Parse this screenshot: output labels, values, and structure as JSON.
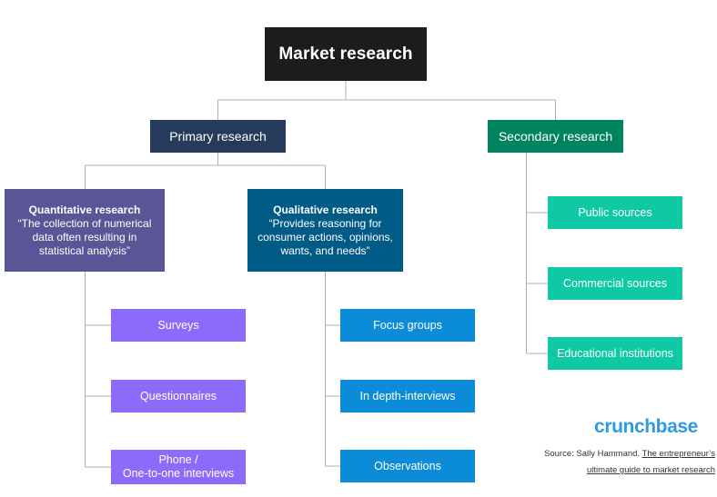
{
  "diagram": {
    "root": {
      "label": "Market research"
    },
    "branches": [
      {
        "id": "primary",
        "label": "Primary research"
      },
      {
        "id": "secondary",
        "label": "Secondary research"
      }
    ],
    "definitions": [
      {
        "id": "quantitative",
        "title": "Quantitative research",
        "description": "“The collection of numerical data often resulting in statistical analysis”"
      },
      {
        "id": "qualitative",
        "title": "Qualitative research",
        "description": "“Provides reasoning for consumer actions, opinions, wants, and needs”"
      }
    ],
    "quantitative_methods": [
      {
        "label": "Surveys"
      },
      {
        "label": "Questionnaires"
      },
      {
        "label": "Phone /\nOne-to-one interviews"
      }
    ],
    "qualitative_methods": [
      {
        "label": "Focus groups"
      },
      {
        "label": "In depth-interviews"
      },
      {
        "label": "Observations"
      }
    ],
    "secondary_sources": [
      {
        "label": "Public sources"
      },
      {
        "label": "Commercial sources"
      },
      {
        "label": "Educational institutions"
      }
    ]
  },
  "footer": {
    "brand": "crunchbase",
    "source_prefix": "Source: Sally Hammand.",
    "source_link_line1": "The entrepreneur’s",
    "source_link_line2": "ultimate guide to market research"
  },
  "colors": {
    "root": "#1c1c1c",
    "primary": "#263a5c",
    "secondary": "#00835f",
    "quantitative": "#5a5596",
    "qualitative": "#005c86",
    "quantitative_leaf": "#8c6bfa",
    "qualitative_leaf": "#0c8cd8",
    "secondary_leaf": "#0fc9a4",
    "connector": "#b0b0b0",
    "brand": "#2e9be0",
    "background": "#ffffff"
  }
}
